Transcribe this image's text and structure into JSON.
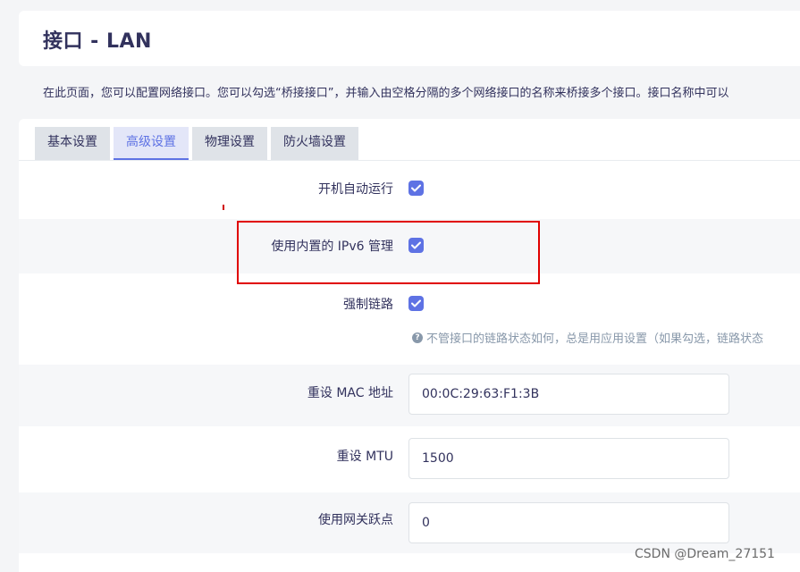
{
  "page": {
    "title": "接口 - LAN",
    "description": "在此页面，您可以配置网络接口。您可以勾选“桥接接口”，并输入由空格分隔的多个网络接口的名称来桥接多个接口。接口名称中可以"
  },
  "tabs": [
    {
      "label": "基本设置",
      "active": false
    },
    {
      "label": "高级设置",
      "active": true
    },
    {
      "label": "物理设置",
      "active": false
    },
    {
      "label": "防火墙设置",
      "active": false
    }
  ],
  "settings": {
    "auto_start": {
      "label": "开机自动运行",
      "checked": true
    },
    "builtin_ipv6": {
      "label": "使用内置的 IPv6 管理",
      "checked": true
    },
    "force_link": {
      "label": "强制链路",
      "checked": true,
      "help": "不管接口的链路状态如何，总是用应用设置（如果勾选，链路状态"
    },
    "override_mac": {
      "label": "重设 MAC 地址",
      "value": "00:0C:29:63:F1:3B"
    },
    "override_mtu": {
      "label": "重设 MTU",
      "value": "1500"
    },
    "gateway_metric": {
      "label": "使用网关跃点",
      "value": "0"
    }
  },
  "watermark": "CSDN @Dream_27151",
  "colors": {
    "accent": "#5e72e4",
    "highlight": "#e00000"
  },
  "icons": {
    "checkbox_check": "check-icon",
    "help": "question-circle-icon"
  }
}
